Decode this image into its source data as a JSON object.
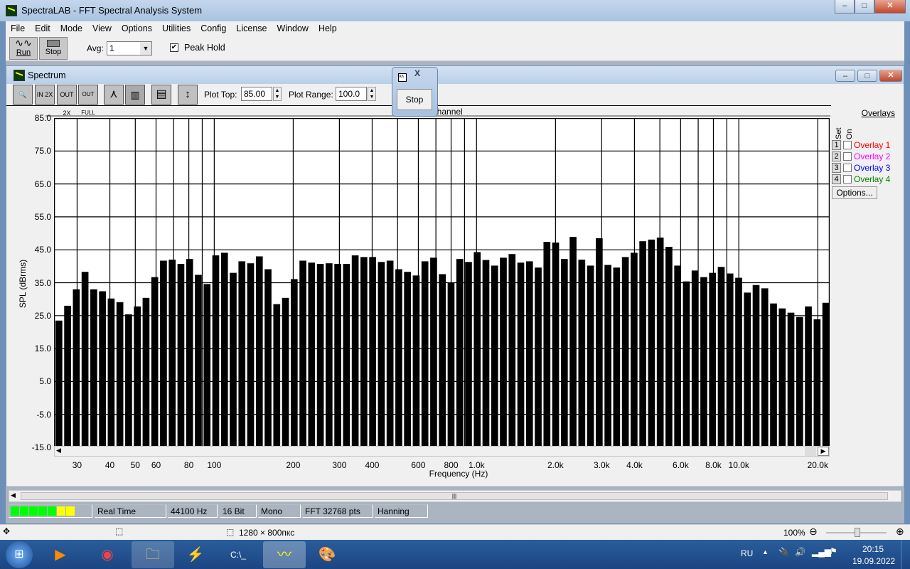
{
  "window": {
    "title": "SpectraLAB - FFT Spectral Analysis System",
    "minimize": "–",
    "maximize": "□",
    "close": "✕"
  },
  "menu": [
    "File",
    "Edit",
    "Mode",
    "View",
    "Options",
    "Utilities",
    "Config",
    "License",
    "Window",
    "Help"
  ],
  "toolbar": {
    "run": "Run",
    "stop": "Stop",
    "avg_label": "Avg:",
    "avg_value": "1",
    "peak_hold": "Peak Hold",
    "peak_hold_checked": true
  },
  "spectrum": {
    "title": "Spectrum",
    "plot_top_label": "Plot Top:",
    "plot_top": "85.00",
    "plot_range_label": "Plot Range:",
    "plot_range": "100.0",
    "buttons": [
      "zoom",
      "IN 2X",
      "OUT 2X",
      "OUT FULL",
      "line",
      "bars",
      "table",
      "scale"
    ]
  },
  "floating": {
    "stop": "Stop",
    "close": "X"
  },
  "overlays": {
    "title": "Overlays",
    "set": "Set",
    "on": "On",
    "items": [
      {
        "num": "1",
        "label": "Overlay 1",
        "color": "#ff0000"
      },
      {
        "num": "2",
        "label": "Overlay 2",
        "color": "#ff00ff"
      },
      {
        "num": "3",
        "label": "Overlay 3",
        "color": "#0000ff"
      },
      {
        "num": "4",
        "label": "Overlay 4",
        "color": "#008000"
      }
    ],
    "options": "Options..."
  },
  "chart_data": {
    "type": "bar",
    "title": "Channel",
    "xlabel": "Frequency (Hz)",
    "ylabel": "SPL (dBrms)",
    "ylim": [
      -15,
      85
    ],
    "xlim": [
      24.5,
      22200
    ],
    "xscale": "log",
    "grid": true,
    "yticks": [
      "85.0",
      "75.0",
      "65.0",
      "55.0",
      "45.0",
      "35.0",
      "25.0",
      "15.0",
      "5.0",
      "-5.0",
      "-15.0"
    ],
    "xticks": [
      {
        "f": 30,
        "label": "30"
      },
      {
        "f": 40,
        "label": "40"
      },
      {
        "f": 50,
        "label": "50"
      },
      {
        "f": 60,
        "label": "60"
      },
      {
        "f": 80,
        "label": "80"
      },
      {
        "f": 100,
        "label": "100"
      },
      {
        "f": 200,
        "label": "200"
      },
      {
        "f": 300,
        "label": "300"
      },
      {
        "f": 400,
        "label": "400"
      },
      {
        "f": 600,
        "label": "600"
      },
      {
        "f": 800,
        "label": "800"
      },
      {
        "f": 1000,
        "label": "1.0k"
      },
      {
        "f": 2000,
        "label": "2.0k"
      },
      {
        "f": 3000,
        "label": "3.0k"
      },
      {
        "f": 4000,
        "label": "4.0k"
      },
      {
        "f": 6000,
        "label": "6.0k"
      },
      {
        "f": 8000,
        "label": "8.0k"
      },
      {
        "f": 10000,
        "label": "10.0k"
      },
      {
        "f": 20000,
        "label": "20.0k"
      }
    ],
    "gridlines_hz": [
      30,
      40,
      50,
      60,
      70,
      80,
      90,
      100,
      200,
      300,
      400,
      500,
      600,
      700,
      800,
      900,
      1000,
      2000,
      3000,
      4000,
      5000,
      6000,
      7000,
      8000,
      9000,
      10000,
      20000
    ],
    "values": [
      23.5,
      28,
      33,
      38.3,
      33,
      32.4,
      30.2,
      29.1,
      25.4,
      27.8,
      30.4,
      36.7,
      41.7,
      42,
      40.7,
      42.2,
      37.4,
      34.6,
      43.3,
      44.1,
      38,
      41.5,
      40.9,
      43,
      39.1,
      28.5,
      30.4,
      36.1,
      41.7,
      41.1,
      40.7,
      40.9,
      40.7,
      40.7,
      43.3,
      42.8,
      42.8,
      41.3,
      41.7,
      39.1,
      38.3,
      37.2,
      41.5,
      42.6,
      37.6,
      35,
      42.2,
      41.3,
      44.3,
      41.9,
      40.2,
      42.6,
      43.7,
      41.1,
      41.5,
      39.6,
      47.4,
      47.2,
      42.2,
      48.9,
      42,
      40.2,
      48.5,
      40.4,
      39.6,
      42.8,
      44.1,
      47.6,
      48.1,
      48.7,
      45.9,
      40.2,
      35.4,
      38.7,
      36.7,
      38,
      39.8,
      37.8,
      36.5,
      32,
      34.3,
      33.3,
      28.7,
      27.2,
      25.9,
      24.6,
      27.8,
      23.9,
      28.9
    ]
  },
  "status": {
    "level_segments": [
      "#00ff00",
      "#00ff00",
      "#00ff00",
      "#00ff00",
      "#00ff00",
      "#ffff00",
      "#ffff00"
    ],
    "mode": "Real Time",
    "rate": "44100 Hz",
    "bits": "16 Bit",
    "channels": "Mono",
    "fft": "FFT 32768 pts",
    "window": "Hanning"
  },
  "paint": {
    "size": "1280 × 800пкс",
    "zoom": "100%"
  },
  "taskbar": {
    "lang": "RU",
    "time": "20:15",
    "date": "19.09.2022"
  }
}
